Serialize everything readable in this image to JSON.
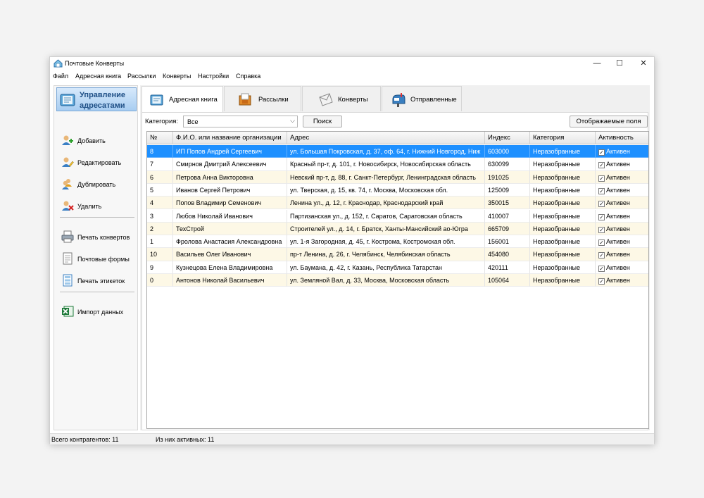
{
  "window": {
    "title": "Почтовые Конверты",
    "controls": {
      "minimize": "—",
      "maximize": "☐",
      "close": "✕"
    }
  },
  "menu": [
    "Файл",
    "Адресная книга",
    "Рассылки",
    "Конверты",
    "Настройки",
    "Справка"
  ],
  "sidebar": {
    "header": "Управление адресатами",
    "actions": [
      {
        "label": "Добавить",
        "icon": "add-person-icon"
      },
      {
        "label": "Редактировать",
        "icon": "edit-person-icon"
      },
      {
        "label": "Дублировать",
        "icon": "duplicate-person-icon"
      },
      {
        "label": "Удалить",
        "icon": "delete-person-icon"
      }
    ],
    "print_actions": [
      {
        "label": "Печать конвертов",
        "icon": "printer-icon"
      },
      {
        "label": "Почтовые формы",
        "icon": "forms-icon"
      },
      {
        "label": "Печать этикеток",
        "icon": "labels-icon"
      }
    ],
    "import": {
      "label": "Импорт данных",
      "icon": "excel-icon"
    }
  },
  "tabs": [
    {
      "label": "Адресная книга",
      "icon": "address-book-icon",
      "active": true
    },
    {
      "label": "Рассылки",
      "icon": "mailing-box-icon",
      "active": false
    },
    {
      "label": "Конверты",
      "icon": "envelope-icon",
      "active": false
    },
    {
      "label": "Отправленные",
      "icon": "mailbox-icon",
      "active": false
    }
  ],
  "toolbar": {
    "category_label": "Категория:",
    "category_value": "Все",
    "search_button": "Поиск",
    "columns_button": "Отображаемые поля"
  },
  "table": {
    "headers": [
      "№",
      "Ф.И.О. или название организации",
      "Адрес",
      "Индекс",
      "Категория",
      "Активность"
    ],
    "rows": [
      {
        "num": "8",
        "name": "ИП Попов Андрей Сергеевич",
        "address": "ул. Большая Покровская, д. 37, оф. 64, г. Нижний Новгород, Ниж",
        "index": "603000",
        "category": "Неразобранные",
        "active": "Активен",
        "selected": true
      },
      {
        "num": "7",
        "name": "Смирнов Дмитрий Алексеевич",
        "address": "Красный пр-т, д. 101, г. Новосибирск, Новосибирская область",
        "index": "630099",
        "category": "Неразобранные",
        "active": "Активен"
      },
      {
        "num": "6",
        "name": "Петрова Анна Викторовна",
        "address": "Невский пр-т, д. 88, г. Санкт-Петербург, Ленинградская область",
        "index": "191025",
        "category": "Неразобранные",
        "active": "Активен"
      },
      {
        "num": "5",
        "name": "Иванов Сергей Петрович",
        "address": "ул. Тверская, д. 15, кв. 74, г. Москва, Московская обл.",
        "index": "125009",
        "category": "Неразобранные",
        "active": "Активен"
      },
      {
        "num": "4",
        "name": "Попов Владимир Семенович",
        "address": "Ленина ул., д. 12, г. Краснодар, Краснодарский край",
        "index": "350015",
        "category": "Неразобранные",
        "active": "Активен"
      },
      {
        "num": "3",
        "name": "Любов Николай Иванович",
        "address": "Партизанская ул., д. 152, г. Саратов, Саратовская область",
        "index": "410007",
        "category": "Неразобранные",
        "active": "Активен"
      },
      {
        "num": "2",
        "name": "ТехСтрой",
        "address": "Строителей ул., д. 14, г. Братск, Ханты-Мансийский ао-Югра",
        "index": "665709",
        "category": "Неразобранные",
        "active": "Активен"
      },
      {
        "num": "1",
        "name": "Фролова Анастасия Александровна",
        "address": "ул. 1-я Загородная, д. 45, г. Кострома, Костромская обл.",
        "index": "156001",
        "category": "Неразобранные",
        "active": "Активен"
      },
      {
        "num": "10",
        "name": "Васильев Олег Иванович",
        "address": "пр-т Ленина, д. 26, г. Челябинск, Челябинская область",
        "index": "454080",
        "category": "Неразобранные",
        "active": "Активен"
      },
      {
        "num": "9",
        "name": "Кузнецова Елена Владимировна",
        "address": "ул. Баумана, д. 42, г. Казань, Республика Татарстан",
        "index": "420111",
        "category": "Неразобранные",
        "active": "Активен"
      },
      {
        "num": "0",
        "name": "Антонов Николай Васильевич",
        "address": "ул. Земляной Вал, д. 33, Москва, Московская область",
        "index": "105064",
        "category": "Неразобранные",
        "active": "Активен"
      }
    ]
  },
  "status": {
    "total": "Всего контрагентов: 11",
    "active": "Из них активных: 11"
  },
  "colors": {
    "selection": "#1e90ff",
    "row_alt": "#fdf8e6",
    "header_accent": "#1f4f86"
  }
}
